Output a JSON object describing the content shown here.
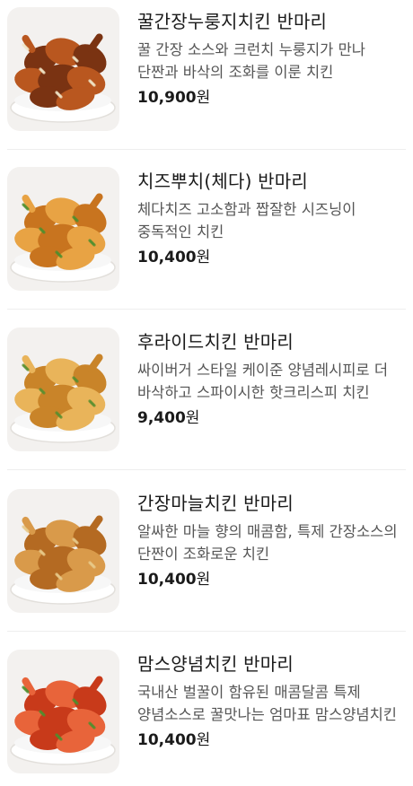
{
  "menu": {
    "items": [
      {
        "name": "꿀간장누룽지치킨 반마리",
        "description": "꿀 간장 소스와 크런치 누룽지가 만나 단짠과 바삭의 조화를 이룬 치킨",
        "price": "10,900",
        "currency": "원",
        "image_icon": "honey-soy-chicken-photo",
        "colors": {
          "base": "#7a3312",
          "highlight": "#b9571f",
          "garnish": "#f0e6c8"
        }
      },
      {
        "name": "치즈뿌치(체다) 반마리",
        "description": "체다치즈 고소함과 짭잘한 시즈닝이 중독적인 치킨",
        "price": "10,400",
        "currency": "원",
        "image_icon": "cheese-chicken-photo",
        "colors": {
          "base": "#c8741f",
          "highlight": "#e8a344",
          "garnish": "#4f8f2e"
        }
      },
      {
        "name": "후라이드치킨 반마리",
        "description": "싸이버거 스타일 케이준 양념레시피로 더 바삭하고 스파이시한 핫크리스피 치킨",
        "price": "9,400",
        "currency": "원",
        "image_icon": "fried-chicken-photo",
        "colors": {
          "base": "#c98429",
          "highlight": "#e9b45a",
          "garnish": "#5a8f2f"
        }
      },
      {
        "name": "간장마늘치킨 반마리",
        "description": "알싸한 마늘 향의 매콤함, 특제 간장소스의 단짠이 조화로운 치킨",
        "price": "10,400",
        "currency": "원",
        "image_icon": "soy-garlic-chicken-photo",
        "colors": {
          "base": "#b46a22",
          "highlight": "#d99a4a",
          "garnish": "#e7c98a"
        }
      },
      {
        "name": "맘스양념치킨 반마리",
        "description": "국내산 벌꿀이 함유된 매콤달콤 특제 양념소스로 꿀맛나는 엄마표 맘스양념치킨",
        "price": "10,400",
        "currency": "원",
        "image_icon": "seasoned-chicken-photo",
        "colors": {
          "base": "#c83a1a",
          "highlight": "#e8643a",
          "garnish": "#4f8f2e"
        }
      }
    ]
  }
}
